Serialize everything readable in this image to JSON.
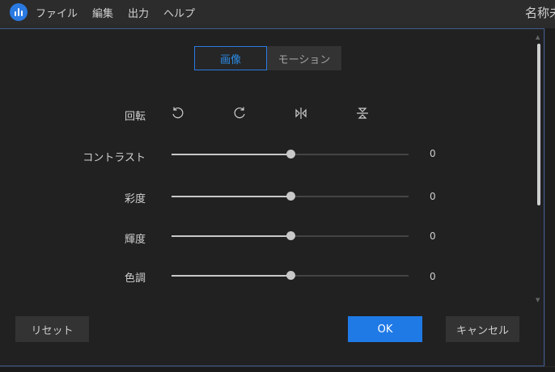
{
  "menubar": {
    "items": [
      "ファイル",
      "編集",
      "出力",
      "ヘルプ"
    ],
    "doc_title": "名称未"
  },
  "dialog": {
    "tabs": [
      {
        "label": "画像",
        "active": true
      },
      {
        "label": "モーション",
        "active": false
      }
    ],
    "rotation": {
      "label": "回転",
      "icons": [
        "rotate-left-icon",
        "rotate-right-icon",
        "flip-horizontal-icon",
        "flip-vertical-icon"
      ]
    },
    "sliders": [
      {
        "label": "コントラスト",
        "value": "0",
        "fraction": 0.5
      },
      {
        "label": "彩度",
        "value": "0",
        "fraction": 0.5
      },
      {
        "label": "輝度",
        "value": "0",
        "fraction": 0.5
      },
      {
        "label": "色調",
        "value": "0",
        "fraction": 0.5
      }
    ],
    "buttons": {
      "reset": "リセット",
      "ok": "OK",
      "cancel": "キャンセル"
    }
  },
  "colors": {
    "accent": "#1f7ae6",
    "background": "#212121",
    "menubar": "#2c2c2c"
  }
}
